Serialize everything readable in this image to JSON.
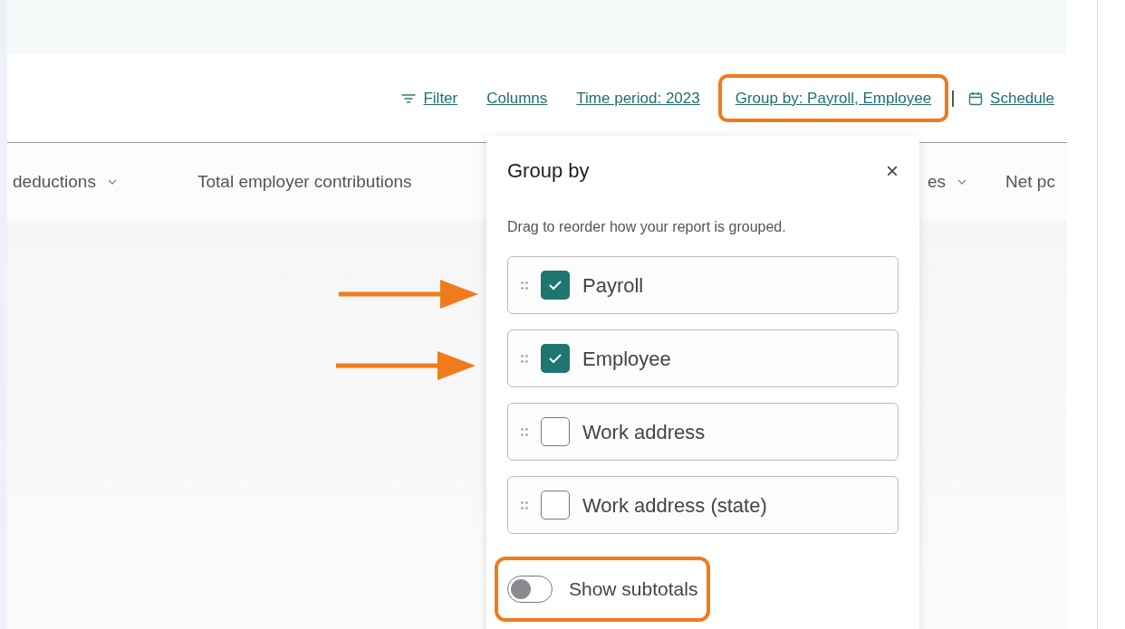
{
  "toolbar": [
    {
      "label": "Filter",
      "kind": "filter",
      "highlighted": false
    },
    {
      "label": "Columns",
      "highlighted": false
    },
    {
      "label": "Time period: 2023",
      "highlighted": false
    },
    {
      "label": "Group by: Payroll, Employee",
      "highlighted": true
    },
    {
      "label": "Schedule",
      "kind": "schedule",
      "highlighted": false
    }
  ],
  "column_headers": [
    {
      "label": "deductions",
      "sortable": true
    },
    {
      "label": "Total employer contributions",
      "sortable": false
    },
    {
      "label": "es",
      "sortable": true
    },
    {
      "label": "Net pc",
      "sortable": false
    }
  ],
  "popover": {
    "title": "Group by",
    "close": "×",
    "description": "Drag to reorder how your report is grouped.",
    "options": [
      {
        "label": "Payroll",
        "checked": true,
        "arrow": true
      },
      {
        "label": "Employee",
        "checked": true,
        "arrow": true
      },
      {
        "label": "Work address",
        "checked": false,
        "arrow": false
      },
      {
        "label": "Work address (state)",
        "checked": false,
        "arrow": false
      }
    ],
    "subtotals": {
      "label": "Show subtotals",
      "on": false,
      "highlighted": true
    }
  }
}
